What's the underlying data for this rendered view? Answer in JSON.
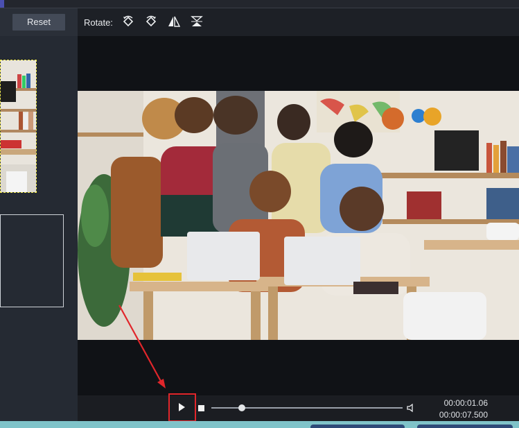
{
  "toolbar": {
    "reset_label": "Reset",
    "rotate_label": "Rotate:",
    "rotate_icons": [
      "rotate-left-icon",
      "rotate-right-icon",
      "flip-horizontal-icon",
      "flip-vertical-icon"
    ]
  },
  "player": {
    "current_time": "00:00:01.06",
    "total_time": "00:00:07.500",
    "progress": 0.16
  },
  "colors": {
    "annotation": "#e1262b",
    "thumb_border": "#f1e94a",
    "bottom_strip": "#7fc3c9"
  }
}
